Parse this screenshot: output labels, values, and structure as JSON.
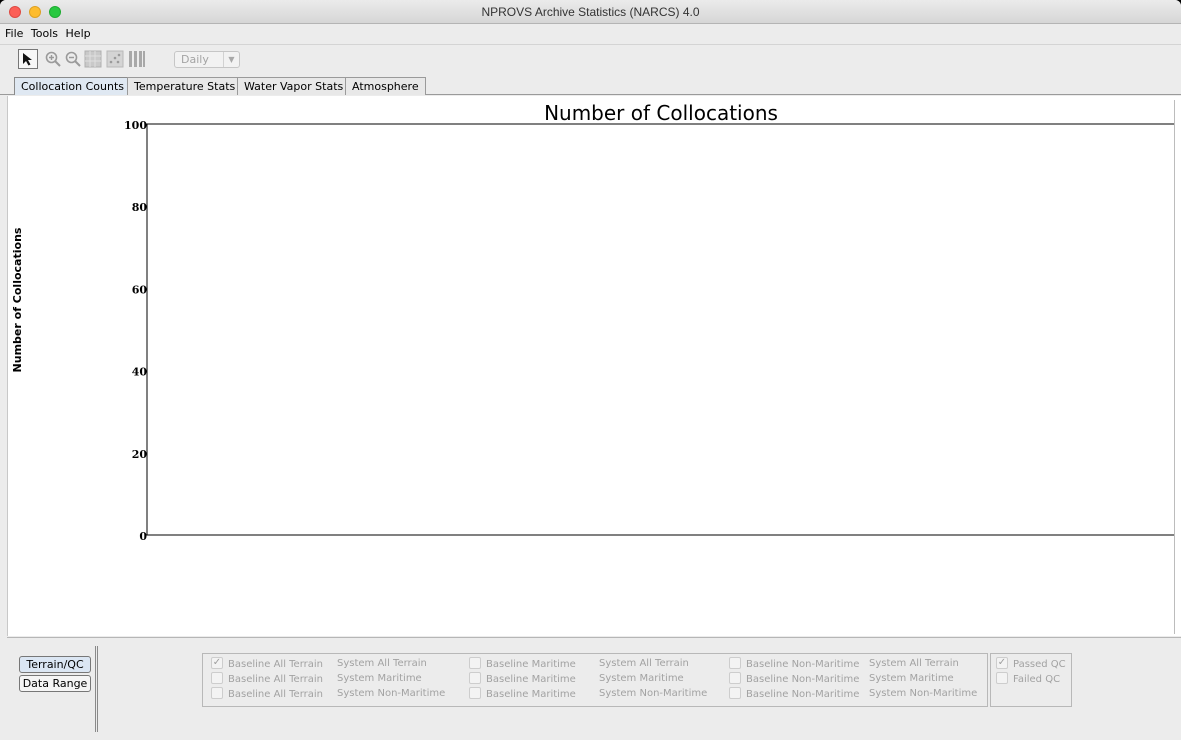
{
  "window": {
    "title": "NPROVS Archive Statistics (NARCS) 4.0"
  },
  "menu": [
    "File",
    "Tools",
    "Help"
  ],
  "toolbar": {
    "icons": [
      "arrow-select-icon",
      "zoom-in-icon",
      "zoom-out-icon",
      "grid-icon",
      "scatter-icon",
      "bars-icon"
    ],
    "period": "Daily"
  },
  "tabs": [
    {
      "label": "Collocation Counts",
      "active": true
    },
    {
      "label": "Temperature Stats",
      "active": false
    },
    {
      "label": "Water Vapor Stats",
      "active": false
    },
    {
      "label": "Atmosphere",
      "active": false
    }
  ],
  "chart_data": {
    "type": "bar",
    "title": "Number of Collocations",
    "ylabel": "Number of Collocations",
    "xlabel": "",
    "ylim": [
      0,
      100
    ],
    "yticks": [
      0,
      20,
      40,
      60,
      80,
      100
    ],
    "categories": [],
    "values": []
  },
  "side_tabs": [
    {
      "label": "Terrain/QC",
      "active": true
    },
    {
      "label": "Data Range",
      "active": false
    }
  ],
  "filters": {
    "rows": [
      [
        {
          "baseline": "Baseline All Terrain",
          "system": "System All Terrain",
          "checked": true
        },
        {
          "baseline": "Baseline Maritime",
          "system": "System All Terrain",
          "checked": false
        },
        {
          "baseline": "Baseline Non-Maritime",
          "system": "System All Terrain",
          "checked": false
        }
      ],
      [
        {
          "baseline": "Baseline All Terrain",
          "system": "System Maritime",
          "checked": false
        },
        {
          "baseline": "Baseline Maritime",
          "system": "System Maritime",
          "checked": false
        },
        {
          "baseline": "Baseline Non-Maritime",
          "system": "System Maritime",
          "checked": false
        }
      ],
      [
        {
          "baseline": "Baseline All Terrain",
          "system": "System Non-Maritime",
          "checked": false
        },
        {
          "baseline": "Baseline Maritime",
          "system": "System Non-Maritime",
          "checked": false
        },
        {
          "baseline": "Baseline Non-Maritime",
          "system": "System Non-Maritime",
          "checked": false
        }
      ]
    ],
    "qc": [
      {
        "label": "Passed QC",
        "checked": true
      },
      {
        "label": "Failed QC",
        "checked": false
      }
    ]
  }
}
